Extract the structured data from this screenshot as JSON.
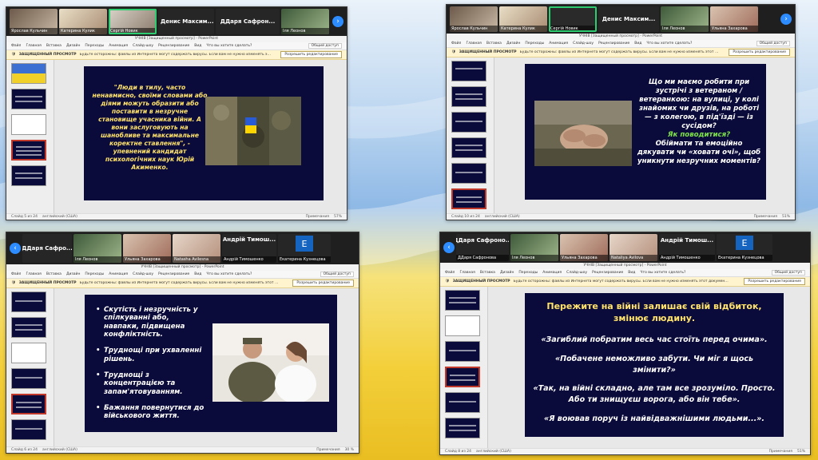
{
  "panel1": {
    "participants": [
      "Ярослав Кульчин",
      "Катерина Кулик",
      "Сергій Новик",
      "Денис Максимчук"
    ],
    "big_names": [
      "Денис Максим...",
      "ДДаря Сафрон..."
    ],
    "last_caption": "Іля Леонов",
    "ppt_title": "УЧНІВ [Защищенный просмотр] - PowerPoint",
    "ribbon": [
      "Файл",
      "Главная",
      "Вставка",
      "Дизайн",
      "Переходы",
      "Анимация",
      "Слайд-шоу",
      "Рецензирование",
      "Вид",
      "Что вы хотите сделать?",
      "Общий доступ"
    ],
    "protected_label": "ЗАЩИЩЕННЫЙ ПРОСМОТР",
    "protected_text": "Будьте осторожны: файлы из Интернета могут содержать вирусы. Если вам не нужно изменять этот документ, лучше работать с ним в режиме защищенного просмотра.",
    "enable_editing": "Разрешить редактирование",
    "slide_quote": "\"Люди в тилу, часто ненавмисно, своїми словами або діями можуть образити або поставити в незручне становище учасника війни. А вони заслуговують на шанобливе та максимальне коректне ставлення\", - упевнений кандидат психологічних наук Юрій Акименко.",
    "status_left": "Слайд 5 из 24",
    "status_lang": "английский (США)",
    "status_notes": "Примечания",
    "status_zoom": "57%"
  },
  "panel2": {
    "participants": [
      "Ярослав Кульчин",
      "Катерина Кулик",
      "Сергій Новик"
    ],
    "big_name": "Денис Максим...",
    "captions_after": [
      "Іля Леонов",
      "Ульяна Захарова"
    ],
    "ppt_title": "УЧНІВ [Защищенный просмотр] - PowerPoint",
    "slide_main": "Що ми маємо робити при зустрічі з ветераном / ветеранкою: на вулиці, у колі знайомих чи друзів, на роботі — з колегою, в під'їзді — із сусідом?",
    "slide_green": "Як поводитися?",
    "slide_tail": "Обіймати та емоційно дякувати чи «ховати очі», щоб уникнути незручних моментів?",
    "status_left": "Слайд 10 из 24",
    "status_lang": "английский (США)",
    "status_notes": "Примечания",
    "status_zoom": "51%"
  },
  "panel3": {
    "big_names": [
      "ДДаря Сафро...",
      "Андрій Тимош..."
    ],
    "captions": [
      "ДДаря Сафронова",
      "Іля Леонов",
      "Ульяна Захарова",
      "Natasha Avilesna",
      "Андрій Тимошенко",
      "Екатерина Кузнецова"
    ],
    "avatar_letter": "E",
    "ppt_title": "УЧНІВ [Защищенный просмотр] - PowerPoint",
    "bullets": [
      "Скутість і незручність у спілкуванні або, навпаки, підвищена конфліктність.",
      "Труднощі при ухваленні рішень.",
      "Труднощі з концентрацією та запам'ятовуванням.",
      "Бажання повернутися до військового життя."
    ],
    "status_left": "Слайд 6 из 24",
    "status_lang": "английский (США)",
    "status_notes": "Примечания",
    "status_zoom": "30 %"
  },
  "panel4": {
    "big_names": [
      "ДДаря Сафроно...",
      "Андрій Тимош..."
    ],
    "captions": [
      "ДДаря Сафронова",
      "Іля Леонов",
      "Ульяна Захарова",
      "Nataliya Avilova",
      "Андрій Тимошенко",
      "Екатерина Кузнецова"
    ],
    "avatar_letter": "E",
    "ppt_title": "УЧНІВ [Защищенный просмотр] - PowerPoint",
    "slide_title": "Пережите на війні залишає свій відбиток, змінює людину.",
    "quotes": [
      "«Загиблий побратим весь час стоїть перед очима».",
      "«Побачене неможливо забути. Чи міг я щось змінити?»",
      "«Так, на війні складно, але там все зрозуміло. Просто. Або ти знищуєш ворога, або він тебе».",
      "«Я воював поруч із найвідважнішими людьми...»."
    ],
    "status_left": "Слайд 8 из 24",
    "status_lang": "английский (США)",
    "status_notes": "Примечания",
    "status_zoom": "51%"
  },
  "colors": {
    "slide_bg": "#0b0b3b",
    "quote_yellow": "#ffe36b",
    "green_accent": "#7ee34a",
    "zoom_bar": "#1f1f1f",
    "protected_bg": "#fff4ce"
  }
}
